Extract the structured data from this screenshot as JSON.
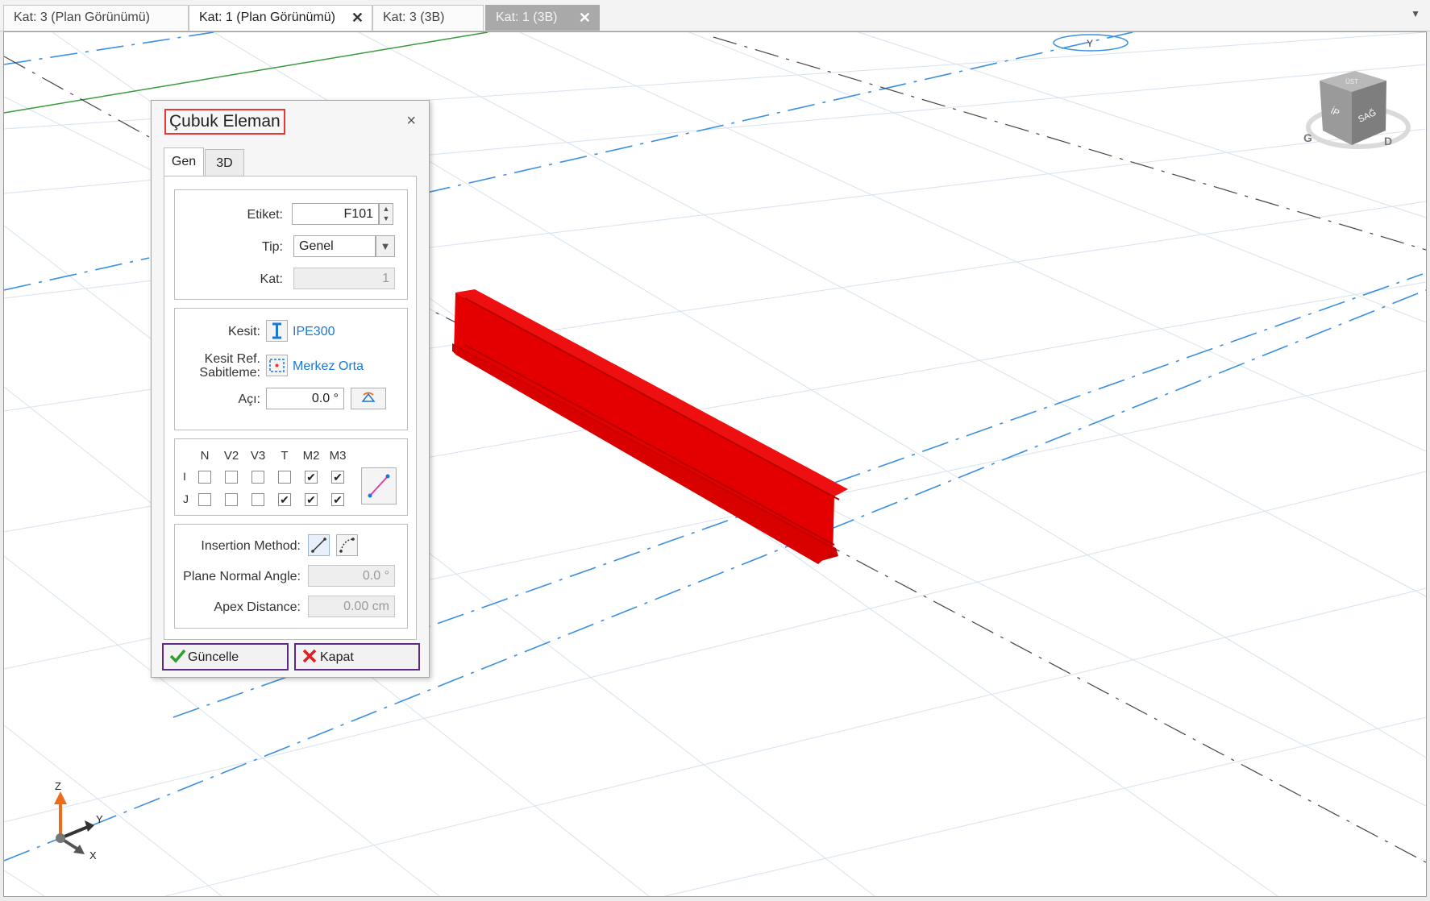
{
  "tabs": [
    {
      "label": "Kat: 3 (Plan Görünümü)",
      "closable": false,
      "state": "normal"
    },
    {
      "label": "Kat: 1 (Plan Görünümü)",
      "closable": true,
      "state": "active"
    },
    {
      "label": "Kat: 3 (3B)",
      "closable": false,
      "state": "normal"
    },
    {
      "label": "Kat: 1 (3B)",
      "closable": true,
      "state": "selected"
    }
  ],
  "tab_close_glyph": "✕",
  "tab_overflow_glyph": "▼",
  "viewport": {
    "view_cube": {
      "left_label": "İP",
      "right_label": "SAĞ",
      "top_label": "ÜST",
      "compass_left": "G",
      "compass_right": "D",
      "north_marker": "Y"
    },
    "axes": {
      "z": "Z",
      "y": "Y",
      "x": "X"
    },
    "element_color": "#e40000"
  },
  "dialog": {
    "title": "Çubuk Eleman",
    "close_glyph": "×",
    "tabs": [
      "Gen",
      "3D"
    ],
    "general": {
      "etiket_label": "Etiket:",
      "etiket_value": "F101",
      "tip_label": "Tip:",
      "tip_value": "Genel",
      "kat_label": "Kat:",
      "kat_value": "1"
    },
    "section": {
      "kesit_label": "Kesit:",
      "kesit_value": "IPE300",
      "ref_label_1": "Kesit Ref.",
      "ref_label_2": "Sabitleme:",
      "ref_value": "Merkez Orta",
      "aci_label": "Açı:",
      "aci_value": "0.0 °"
    },
    "releases": {
      "headers": [
        "N",
        "V2",
        "V3",
        "T",
        "M2",
        "M3"
      ],
      "rows": [
        {
          "label": "I",
          "checks": [
            false,
            false,
            false,
            false,
            true,
            true
          ]
        },
        {
          "label": "J",
          "checks": [
            false,
            false,
            false,
            true,
            true,
            true
          ]
        }
      ]
    },
    "insertion": {
      "method_label": "Insertion Method:",
      "plane_label": "Plane Normal Angle:",
      "plane_value": "0.0 °",
      "apex_label": "Apex Distance:",
      "apex_value": "0.00 cm"
    },
    "buttons": {
      "update": "Güncelle",
      "close": "Kapat"
    }
  }
}
